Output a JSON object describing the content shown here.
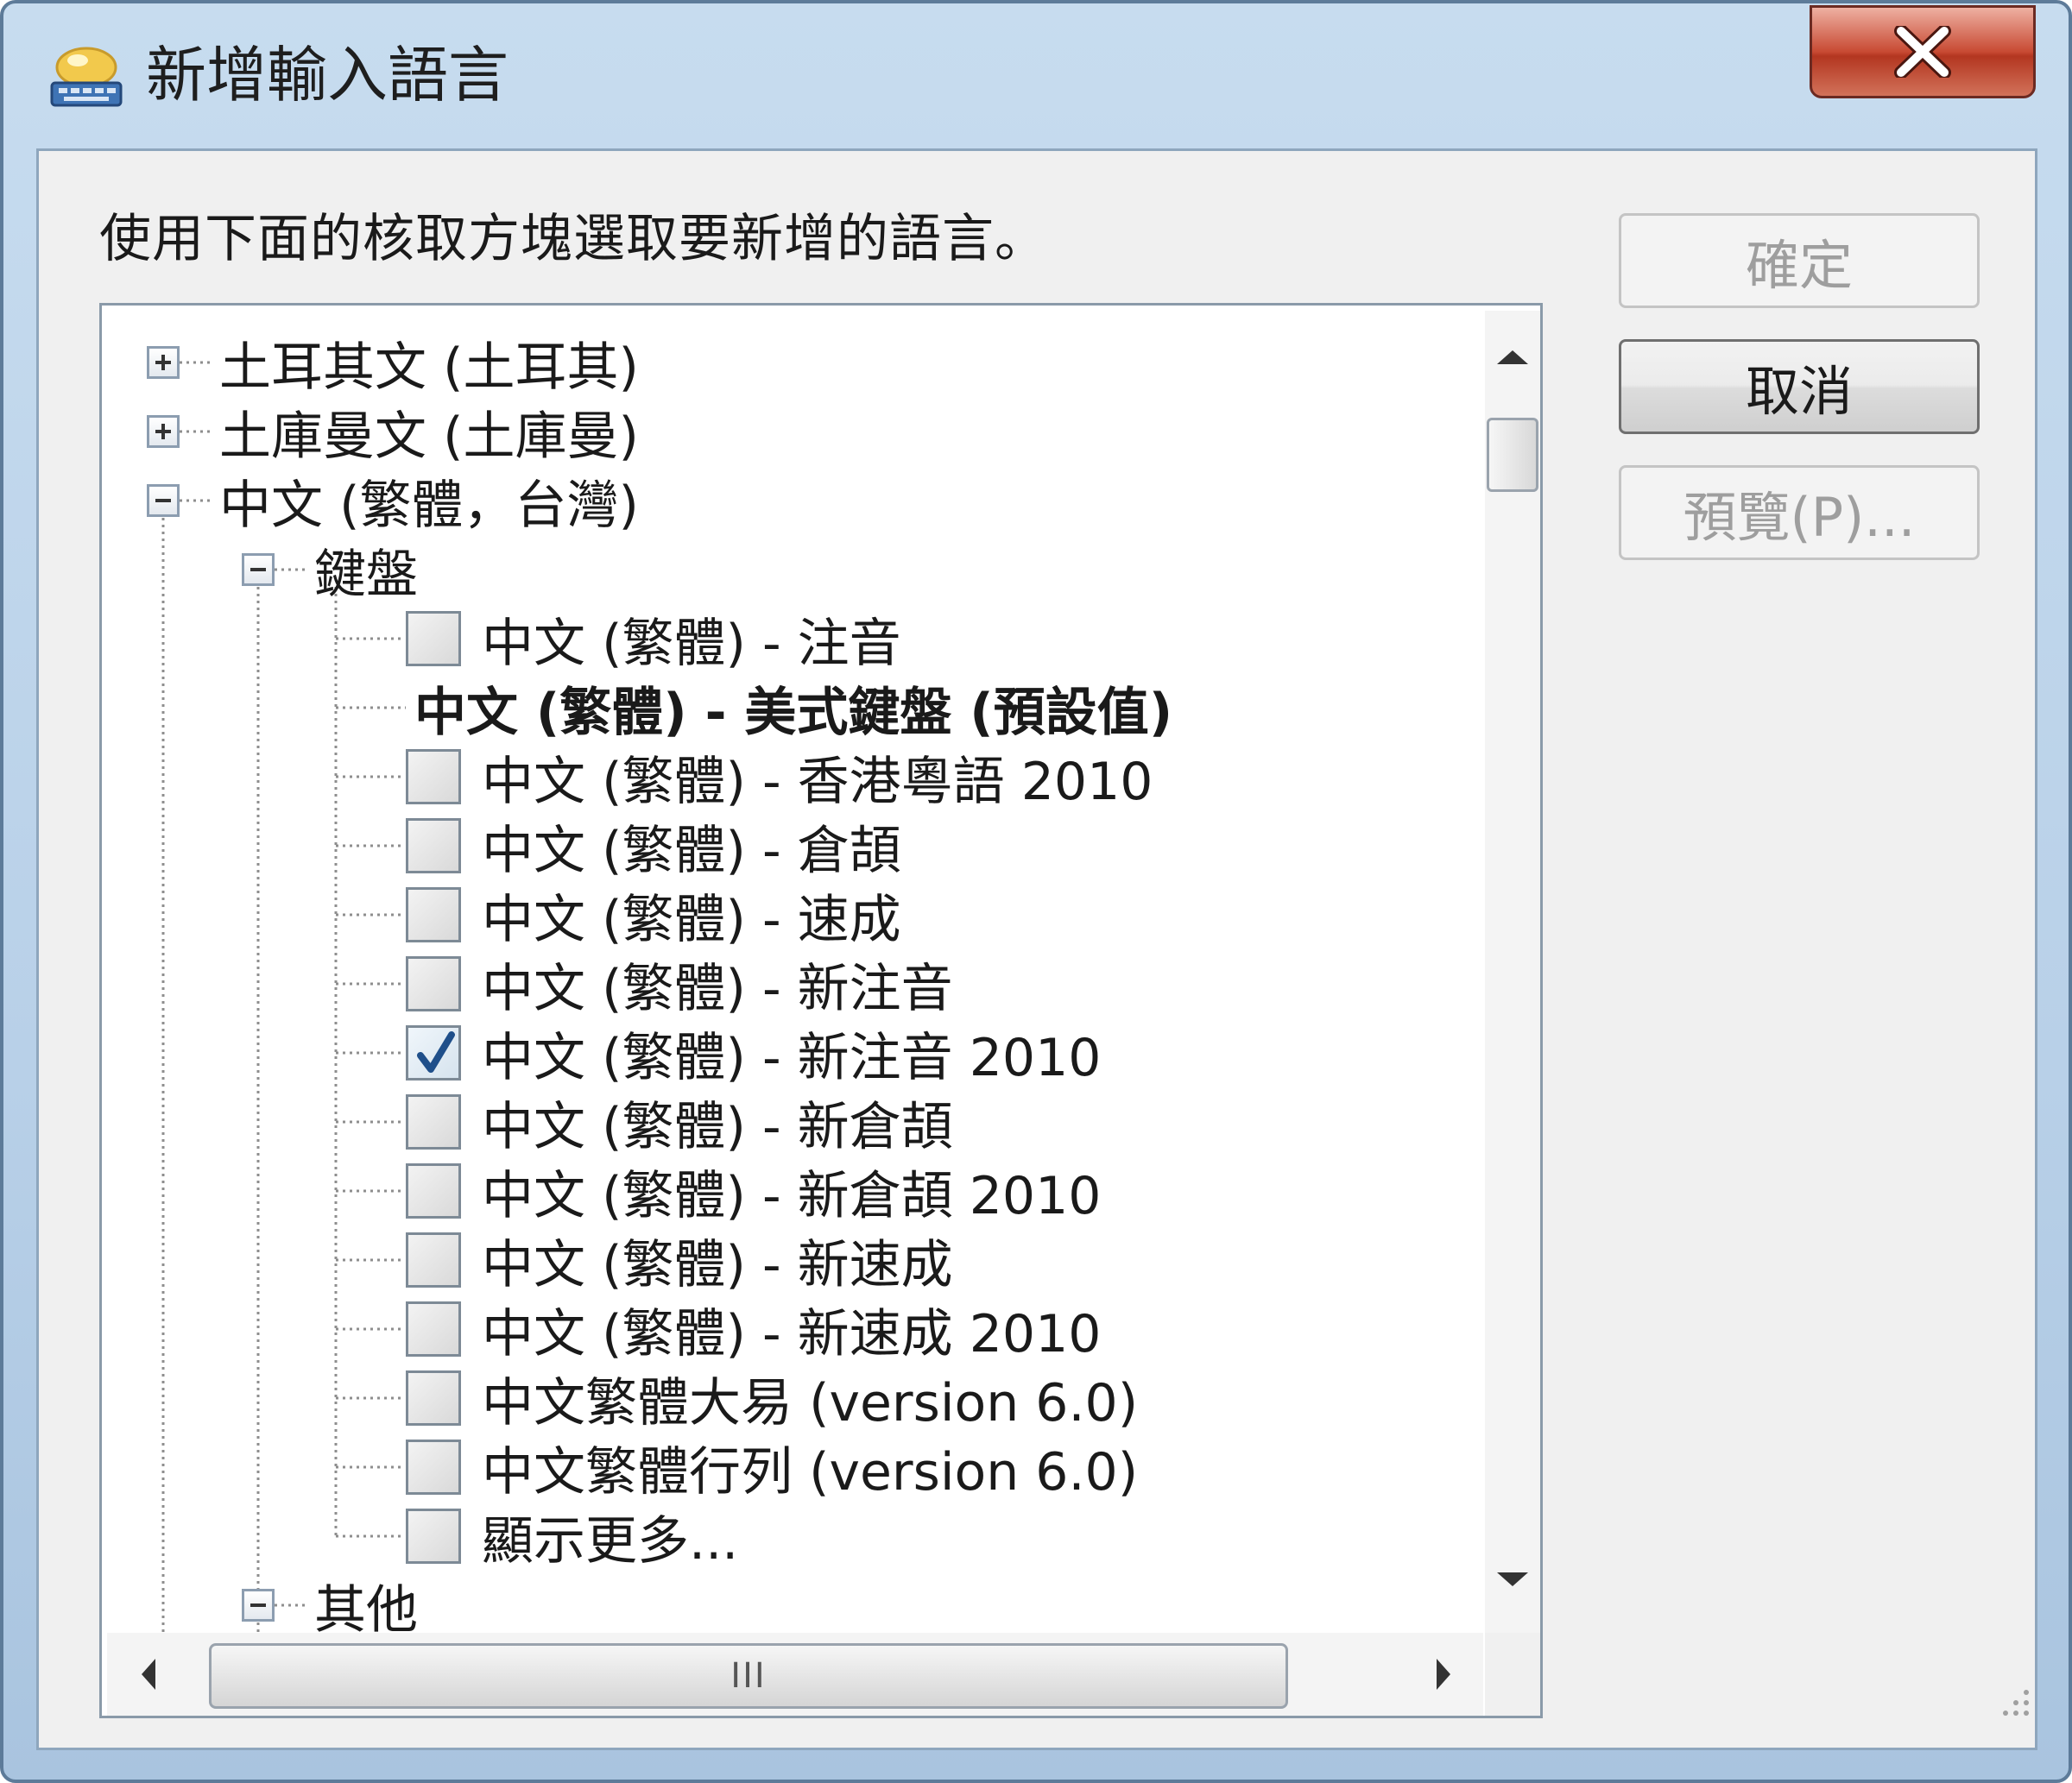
{
  "window": {
    "title": "新增輸入語言",
    "close_glyph": "X"
  },
  "instruction": "使用下面的核取方塊選取要新增的語言。",
  "buttons": {
    "ok": "確定",
    "cancel": "取消",
    "preview": "預覽(P)..."
  },
  "tree": {
    "languages": [
      {
        "label": "土耳其文 (土耳其)",
        "expander": "plus"
      },
      {
        "label": "土庫曼文 (土庫曼)",
        "expander": "plus"
      },
      {
        "label": "中文 (繁體，台灣)",
        "expander": "minus"
      }
    ],
    "keyboard_group": {
      "label": "鍵盤",
      "expander": "minus"
    },
    "keyboards": [
      {
        "label": "中文 (繁體) - 注音",
        "checkbox": true,
        "checked": false
      },
      {
        "label": "中文 (繁體) - 美式鍵盤 (預設值)",
        "checkbox": false,
        "bold": true
      },
      {
        "label": "中文 (繁體) - 香港粵語 2010",
        "checkbox": true,
        "checked": false
      },
      {
        "label": "中文 (繁體) - 倉頡",
        "checkbox": true,
        "checked": false
      },
      {
        "label": "中文 (繁體) - 速成",
        "checkbox": true,
        "checked": false
      },
      {
        "label": "中文 (繁體) - 新注音",
        "checkbox": true,
        "checked": false
      },
      {
        "label": "中文 (繁體) - 新注音 2010",
        "checkbox": true,
        "checked": true
      },
      {
        "label": "中文 (繁體) - 新倉頡",
        "checkbox": true,
        "checked": false
      },
      {
        "label": "中文 (繁體) - 新倉頡 2010",
        "checkbox": true,
        "checked": false
      },
      {
        "label": "中文 (繁體) - 新速成",
        "checkbox": true,
        "checked": false
      },
      {
        "label": "中文 (繁體) - 新速成 2010",
        "checkbox": true,
        "checked": false
      },
      {
        "label": "中文繁體大易 (version 6.0)",
        "checkbox": true,
        "checked": false
      },
      {
        "label": "中文繁體行列 (version 6.0)",
        "checkbox": true,
        "checked": false
      },
      {
        "label": "顯示更多...",
        "checkbox": true,
        "checked": false
      }
    ],
    "other_group": {
      "label": "其他",
      "expander": "minus"
    }
  },
  "scrollbar": {
    "h_thumb_glyph": "III"
  },
  "colors": {
    "close_button": "#c84a33",
    "frame": "#b8d0e8",
    "check_mark": "#1f4f8a"
  }
}
